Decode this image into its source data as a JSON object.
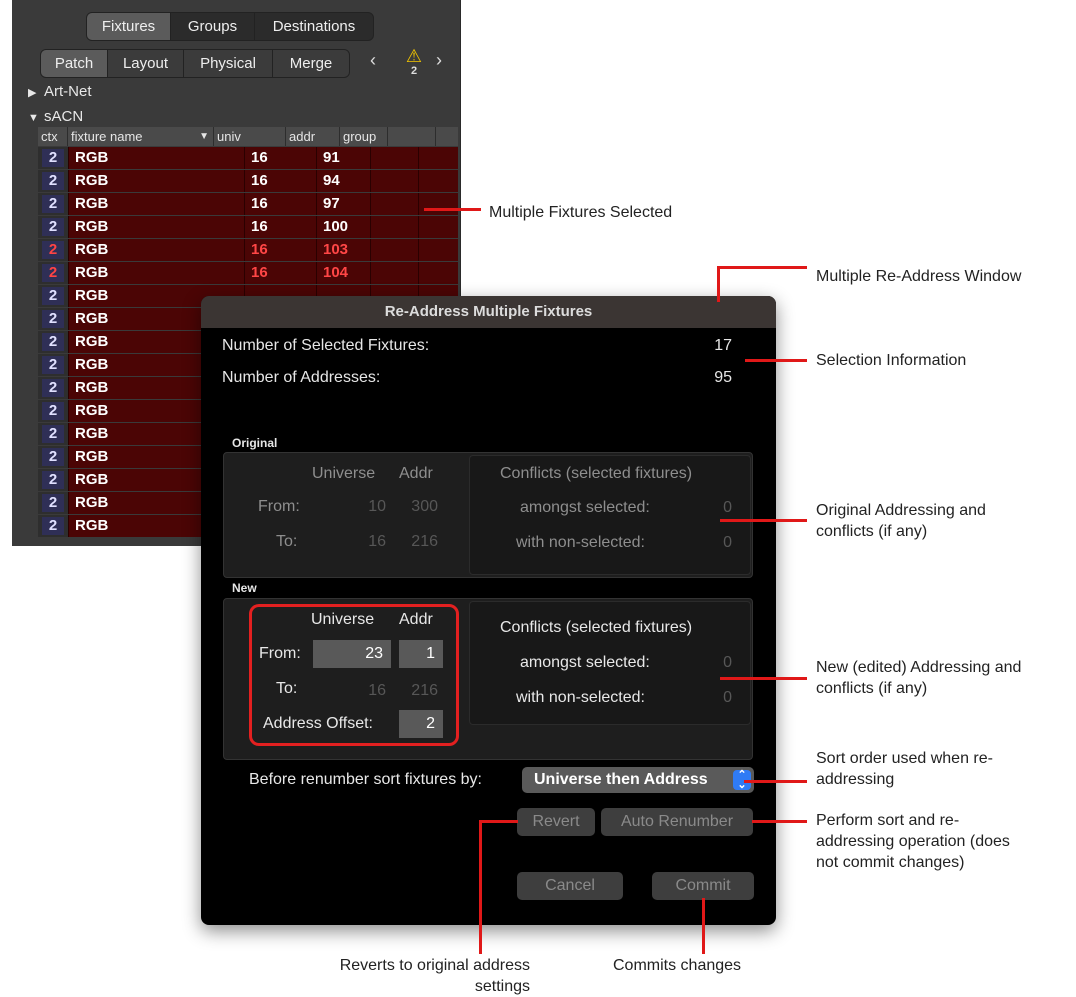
{
  "panel": {
    "top_tabs": [
      "Fixtures",
      "Groups",
      "Destinations"
    ],
    "sub_tabs": [
      "Patch",
      "Layout",
      "Physical",
      "Merge"
    ],
    "warning_count": "2",
    "tree": [
      "Art-Net",
      "sACN"
    ],
    "columns": [
      "ctx",
      "fixture name",
      "univ",
      "addr",
      "group"
    ],
    "rows": [
      {
        "ctx": "2",
        "name": "RGB",
        "univ": "16",
        "addr": "91"
      },
      {
        "ctx": "2",
        "name": "RGB",
        "univ": "16",
        "addr": "94"
      },
      {
        "ctx": "2",
        "name": "RGB",
        "univ": "16",
        "addr": "97"
      },
      {
        "ctx": "2",
        "name": "RGB",
        "univ": "16",
        "addr": "100"
      },
      {
        "ctx": "2",
        "name": "RGB",
        "univ": "16",
        "addr": "103",
        "conflict": true
      },
      {
        "ctx": "2",
        "name": "RGB",
        "univ": "16",
        "addr": "104",
        "conflict": true
      },
      {
        "ctx": "2",
        "name": "RGB",
        "univ": "",
        "addr": ""
      },
      {
        "ctx": "2",
        "name": "RGB",
        "univ": "",
        "addr": ""
      },
      {
        "ctx": "2",
        "name": "RGB",
        "univ": "",
        "addr": ""
      },
      {
        "ctx": "2",
        "name": "RGB",
        "univ": "",
        "addr": ""
      },
      {
        "ctx": "2",
        "name": "RGB",
        "univ": "",
        "addr": ""
      },
      {
        "ctx": "2",
        "name": "RGB",
        "univ": "",
        "addr": ""
      },
      {
        "ctx": "2",
        "name": "RGB",
        "univ": "",
        "addr": ""
      },
      {
        "ctx": "2",
        "name": "RGB",
        "univ": "",
        "addr": ""
      },
      {
        "ctx": "2",
        "name": "RGB",
        "univ": "",
        "addr": ""
      },
      {
        "ctx": "2",
        "name": "RGB",
        "univ": "",
        "addr": ""
      },
      {
        "ctx": "2",
        "name": "RGB",
        "univ": "",
        "addr": ""
      }
    ]
  },
  "dialog": {
    "title": "Re-Address Multiple Fixtures",
    "num_selected_label": "Number of Selected Fixtures:",
    "num_selected": "17",
    "num_addresses_label": "Number of Addresses:",
    "num_addresses": "95",
    "original": {
      "label": "Original",
      "universe_header": "Universe",
      "addr_header": "Addr",
      "from_label": "From:",
      "from_universe": "10",
      "from_addr": "300",
      "to_label": "To:",
      "to_universe": "16",
      "to_addr": "216",
      "conflicts_title": "Conflicts (selected fixtures)",
      "amongst_label": "amongst selected:",
      "amongst": "0",
      "nonselected_label": "with non-selected:",
      "nonselected": "0"
    },
    "new": {
      "label": "New",
      "universe_header": "Universe",
      "addr_header": "Addr",
      "from_label": "From:",
      "from_universe": "23",
      "from_addr": "1",
      "to_label": "To:",
      "to_universe": "16",
      "to_addr": "216",
      "offset_label": "Address Offset:",
      "offset": "2",
      "conflicts_title": "Conflicts (selected fixtures)",
      "amongst_label": "amongst selected:",
      "amongst": "0",
      "nonselected_label": "with non-selected:",
      "nonselected": "0"
    },
    "sort_label": "Before renumber sort fixtures by:",
    "sort_value": "Universe then Address",
    "revert": "Revert",
    "auto_renumber": "Auto Renumber",
    "cancel": "Cancel",
    "commit": "Commit"
  },
  "annotations": {
    "multiple_selected": "Multiple Fixtures Selected",
    "window": "Multiple Re-Address Window",
    "selection_info": "Selection Information",
    "original_1": "Original Addressing and",
    "original_2": "conflicts (if any)",
    "new_1": "New (edited) Addressing and",
    "new_2": "conflicts (if any)",
    "sort_1": "Sort order used when re-",
    "sort_2": "addressing",
    "perform_1": "Perform sort and re-",
    "perform_2": "addressing operation (does",
    "perform_3": "not commit changes)",
    "revert_1": "Reverts to original address",
    "revert_2": "settings",
    "commit_note": "Commits changes"
  },
  "colors": {
    "callout": "#e01818",
    "selected_row": "#4b0505",
    "conflict_text": "#ff4646",
    "dropdown_accent": "#2f7bf5"
  }
}
